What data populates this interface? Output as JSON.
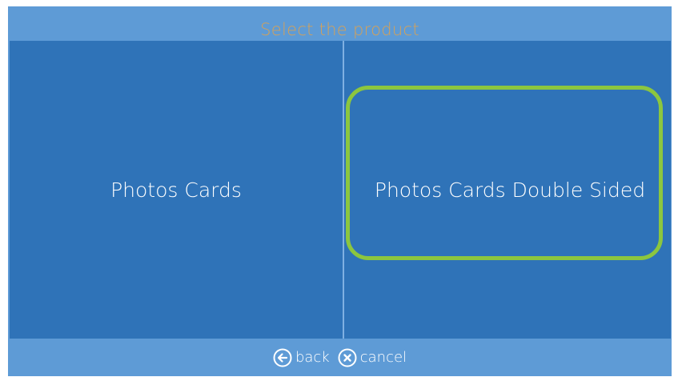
{
  "header": {
    "title": "Select the product"
  },
  "products": [
    {
      "label": "Photos Cards"
    },
    {
      "label": "Photos Cards Double Sided"
    }
  ],
  "footer": {
    "back_label": "back",
    "cancel_label": "cancel"
  },
  "icons": {
    "back": "arrow-left-circle",
    "cancel": "x-circle"
  },
  "colors": {
    "background": "#5e9bd6",
    "tile": "#2f73b8",
    "title": "#e3a24a",
    "highlight": "#8cc63f"
  }
}
